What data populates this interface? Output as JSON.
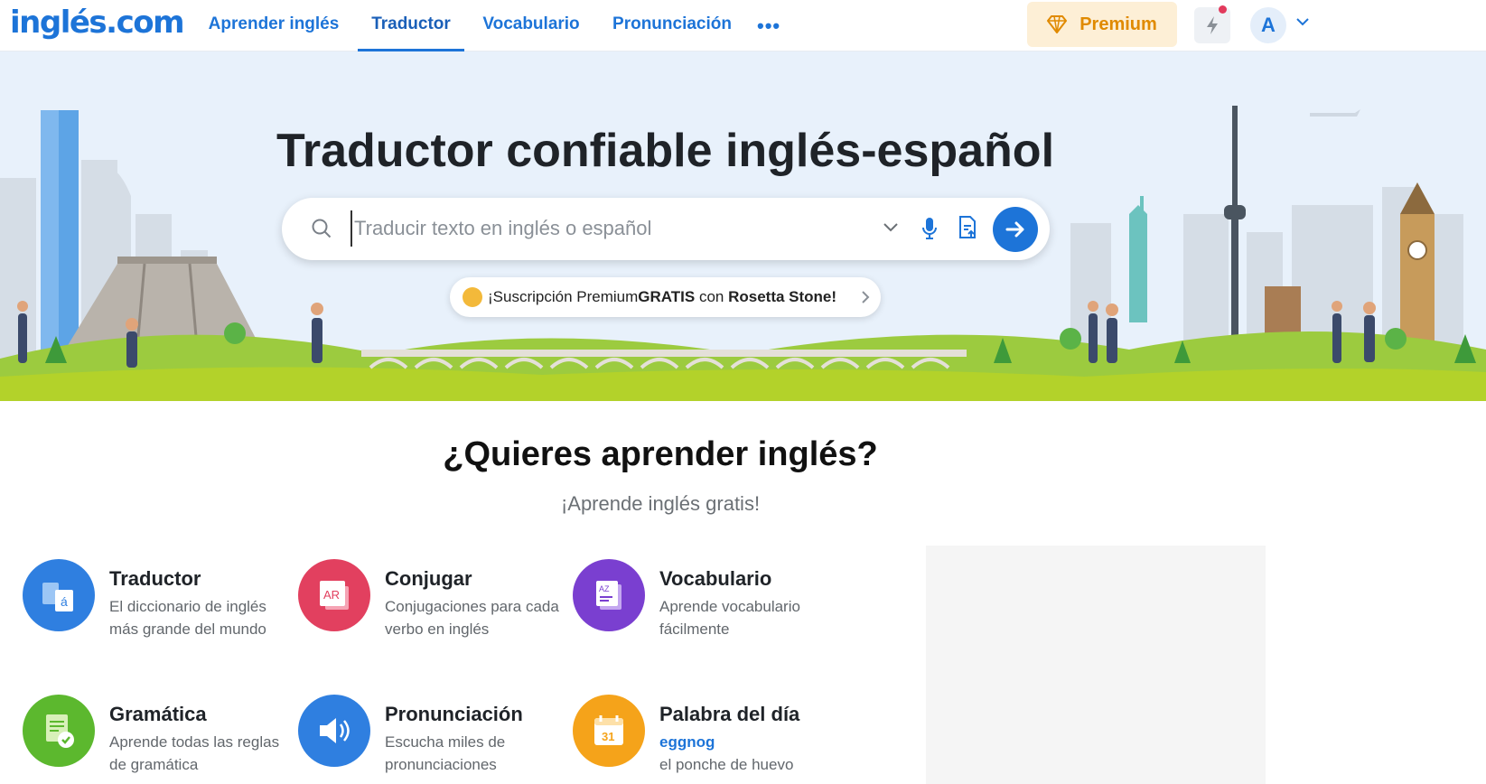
{
  "header": {
    "logo": "inglés.com",
    "nav": [
      "Aprender inglés",
      "Traductor",
      "Vocabulario",
      "Pronunciación"
    ],
    "premium_label": "Premium",
    "avatar_initial": "A"
  },
  "hero": {
    "title": "Traductor confiable inglés-español",
    "search_placeholder": "Traducir texto en inglés o español",
    "promo_pre": "¡Suscripción Premium ",
    "promo_bold1": "GRATIS",
    "promo_mid": " con ",
    "promo_bold2": "Rosetta Stone!"
  },
  "learn": {
    "title": "¿Quieres aprender inglés?",
    "subtitle": "¡Aprende inglés gratis!",
    "cards": [
      {
        "title": "Traductor",
        "desc": "El diccionario de inglés más grande del mundo",
        "icon": "translate-icon",
        "color": "#2f7fe0"
      },
      {
        "title": "Conjugar",
        "desc": "Conjugaciones para cada verbo en inglés",
        "icon": "conjugate-icon",
        "color": "#e2405f"
      },
      {
        "title": "Vocabulario",
        "desc": "Aprende vocabulario fácilmente",
        "icon": "vocabulary-icon",
        "color": "#7a3fd0"
      },
      {
        "title": "Gramática",
        "desc": "Aprende todas las reglas de gramática",
        "icon": "grammar-icon",
        "color": "#5cb82e"
      },
      {
        "title": "Pronunciación",
        "desc": "Escucha miles de pronunciaciones",
        "icon": "pronunciation-icon",
        "color": "#2f7fe0"
      },
      {
        "title": "Palabra del día",
        "word": "eggnog",
        "desc": "el ponche de huevo",
        "icon": "calendar-icon",
        "color": "#f5a31a",
        "calendar_day": "31"
      }
    ]
  },
  "colors": {
    "brand": "#1d74d8",
    "premium_text": "#e08a00",
    "premium_bg": "#fdefd6"
  }
}
